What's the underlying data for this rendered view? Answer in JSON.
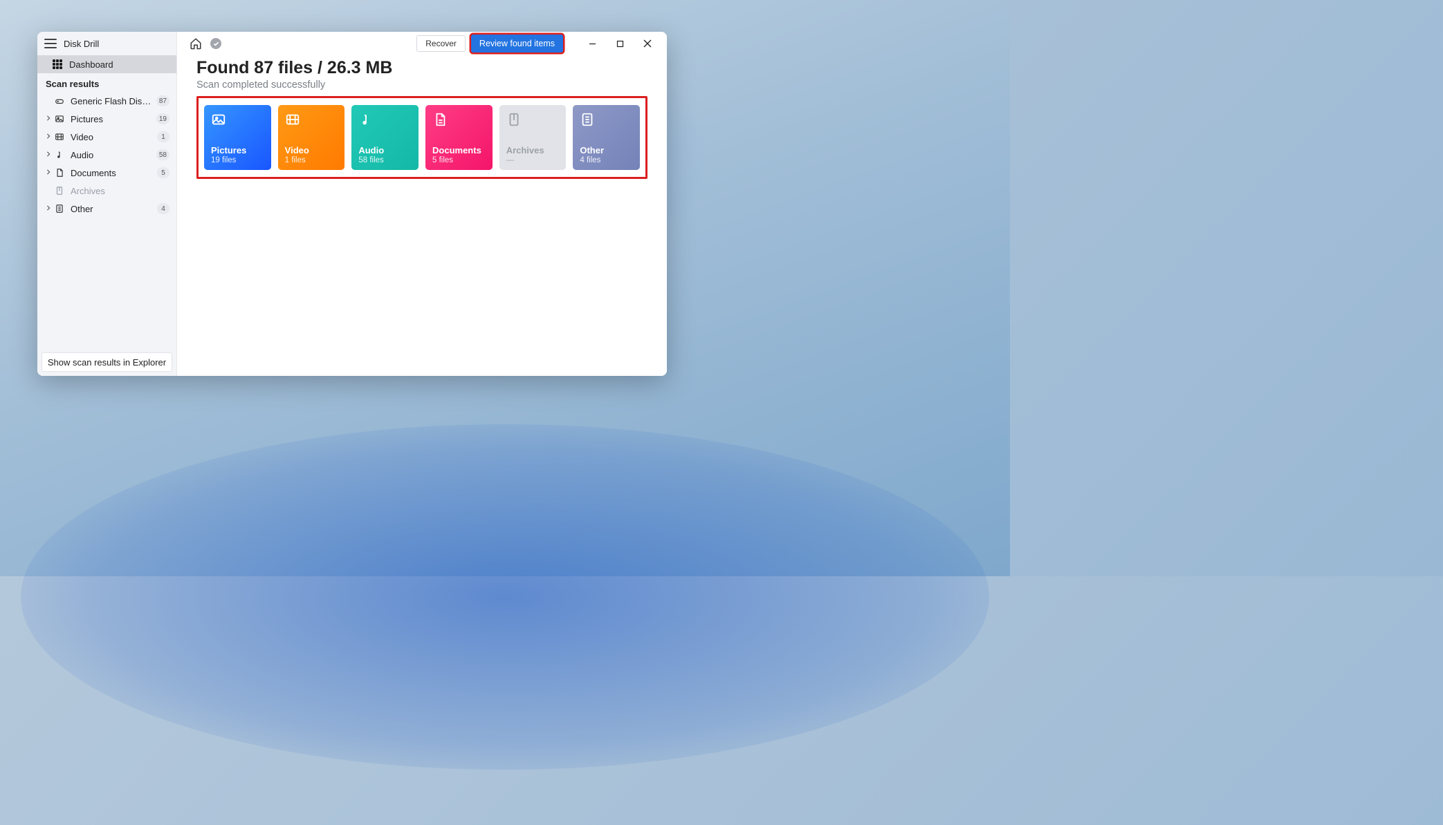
{
  "app": {
    "title": "Disk Drill"
  },
  "sidebar": {
    "dashboard_label": "Dashboard",
    "section_header": "Scan results",
    "items": [
      {
        "label": "Generic Flash Disk USB D…",
        "badge": "87",
        "icon": "disk",
        "chev": false,
        "disabled": false
      },
      {
        "label": "Pictures",
        "badge": "19",
        "icon": "pictures",
        "chev": true,
        "disabled": false
      },
      {
        "label": "Video",
        "badge": "1",
        "icon": "video",
        "chev": true,
        "disabled": false
      },
      {
        "label": "Audio",
        "badge": "58",
        "icon": "audio",
        "chev": true,
        "disabled": false
      },
      {
        "label": "Documents",
        "badge": "5",
        "icon": "documents",
        "chev": true,
        "disabled": false
      },
      {
        "label": "Archives",
        "badge": "",
        "icon": "archives",
        "chev": false,
        "disabled": true
      },
      {
        "label": "Other",
        "badge": "4",
        "icon": "other",
        "chev": true,
        "disabled": false
      }
    ],
    "footer_button": "Show scan results in Explorer"
  },
  "header": {
    "recover": "Recover",
    "review": "Review found items"
  },
  "results": {
    "headline": "Found 87 files / 26.3 MB",
    "subheadline": "Scan completed successfully",
    "total_files": 87,
    "total_size_mb": 26.3
  },
  "cards": [
    {
      "key": "pictures",
      "title": "Pictures",
      "count": "19 files",
      "class": "c-pictures",
      "disabled": false
    },
    {
      "key": "video",
      "title": "Video",
      "count": "1 files",
      "class": "c-video",
      "disabled": false
    },
    {
      "key": "audio",
      "title": "Audio",
      "count": "58 files",
      "class": "c-audio",
      "disabled": false
    },
    {
      "key": "documents",
      "title": "Documents",
      "count": "5 files",
      "class": "c-documents",
      "disabled": false
    },
    {
      "key": "archives",
      "title": "Archives",
      "count": "—",
      "class": "c-archives",
      "disabled": true
    },
    {
      "key": "other",
      "title": "Other",
      "count": "4 files",
      "class": "c-other",
      "disabled": false
    }
  ]
}
